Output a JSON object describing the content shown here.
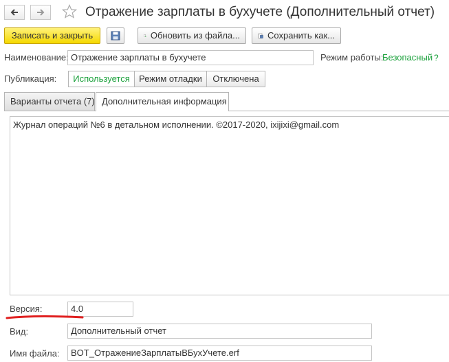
{
  "title": "Отражение зарплаты в бухучете (Дополнительный отчет)",
  "icons": {
    "back": "arrow-left-icon",
    "forward": "arrow-right-icon",
    "favorite": "star-icon",
    "save": "floppy-disk-icon",
    "refresh_from_file": "document-refresh-icon",
    "save_as": "save-as-icon",
    "help": "question-mark-icon"
  },
  "toolbar": {
    "save_close_label": "Записать и закрыть",
    "update_from_file_label": "Обновить из файла...",
    "save_as_label": "Сохранить как..."
  },
  "form": {
    "name_label": "Наименование:",
    "name_value": "Отражение зарплаты в бухучете",
    "mode_label": "Режим работы:",
    "mode_value": "Безопасный",
    "mode_help": "?",
    "publication_label": "Публикация:",
    "publication_options": [
      "Используется",
      "Режим отладки",
      "Отключена"
    ],
    "publication_selected": "Используется"
  },
  "tabs": [
    {
      "label": "Варианты отчета (7)",
      "active": false
    },
    {
      "label": "Дополнительная информация",
      "active": true
    }
  ],
  "info_text": "Журнал операций №6 в детальном исполнении. ©2017-2020, ixijixi@gmail.com",
  "version": {
    "label": "Версия:",
    "value": "4.0"
  },
  "kind": {
    "label": "Вид:",
    "value": "Дополнительный отчет"
  },
  "file_name": {
    "label": "Имя файла:",
    "value": "BOT_ОтражениеЗарплатыВБухУчете.erf"
  },
  "colors": {
    "accent_green": "#19a03a",
    "primary_yellow": "#f5d800",
    "annotation_red": "#e02020"
  }
}
